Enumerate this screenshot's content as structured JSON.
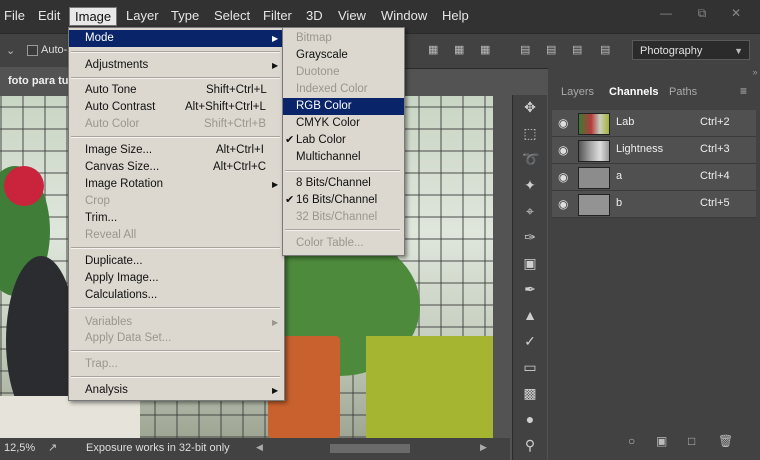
{
  "menubar": {
    "items": [
      "File",
      "Edit",
      "Image",
      "Layer",
      "Type",
      "Select",
      "Filter",
      "3D",
      "View",
      "Window",
      "Help"
    ]
  },
  "optionsbar": {
    "auto_select": "Auto-S",
    "preset": "Photography"
  },
  "document": {
    "tab_title": "foto para tu"
  },
  "status": {
    "zoom": "12,5%",
    "message": "Exposure works in 32-bit only"
  },
  "image_menu": {
    "mode": "Mode",
    "adjustments": "Adjustments",
    "auto_tone": "Auto Tone",
    "auto_tone_key": "Shift+Ctrl+L",
    "auto_contrast": "Auto Contrast",
    "auto_contrast_key": "Alt+Shift+Ctrl+L",
    "auto_color": "Auto Color",
    "auto_color_key": "Shift+Ctrl+B",
    "image_size": "Image Size...",
    "image_size_key": "Alt+Ctrl+I",
    "canvas_size": "Canvas Size...",
    "canvas_size_key": "Alt+Ctrl+C",
    "image_rotation": "Image Rotation",
    "crop": "Crop",
    "trim": "Trim...",
    "reveal_all": "Reveal All",
    "duplicate": "Duplicate...",
    "apply_image": "Apply Image...",
    "calculations": "Calculations...",
    "variables": "Variables",
    "apply_data_set": "Apply Data Set...",
    "trap": "Trap...",
    "analysis": "Analysis"
  },
  "mode_menu": {
    "bitmap": "Bitmap",
    "grayscale": "Grayscale",
    "duotone": "Duotone",
    "indexed_color": "Indexed Color",
    "rgb_color": "RGB Color",
    "cmyk_color": "CMYK Color",
    "lab_color": "Lab Color",
    "multichannel": "Multichannel",
    "bits8": "8 Bits/Channel",
    "bits16": "16 Bits/Channel",
    "bits32": "32 Bits/Channel",
    "color_table": "Color Table..."
  },
  "panels": {
    "tabs": [
      "Layers",
      "Channels",
      "Paths"
    ],
    "channels": [
      {
        "name": "Lab",
        "key": "Ctrl+2"
      },
      {
        "name": "Lightness",
        "key": "Ctrl+3"
      },
      {
        "name": "a",
        "key": "Ctrl+4"
      },
      {
        "name": "b",
        "key": "Ctrl+5"
      }
    ]
  },
  "colors": {
    "highlight": "#0a246a",
    "menu_bg": "#dcd8d0",
    "app_dark": "#323232"
  }
}
